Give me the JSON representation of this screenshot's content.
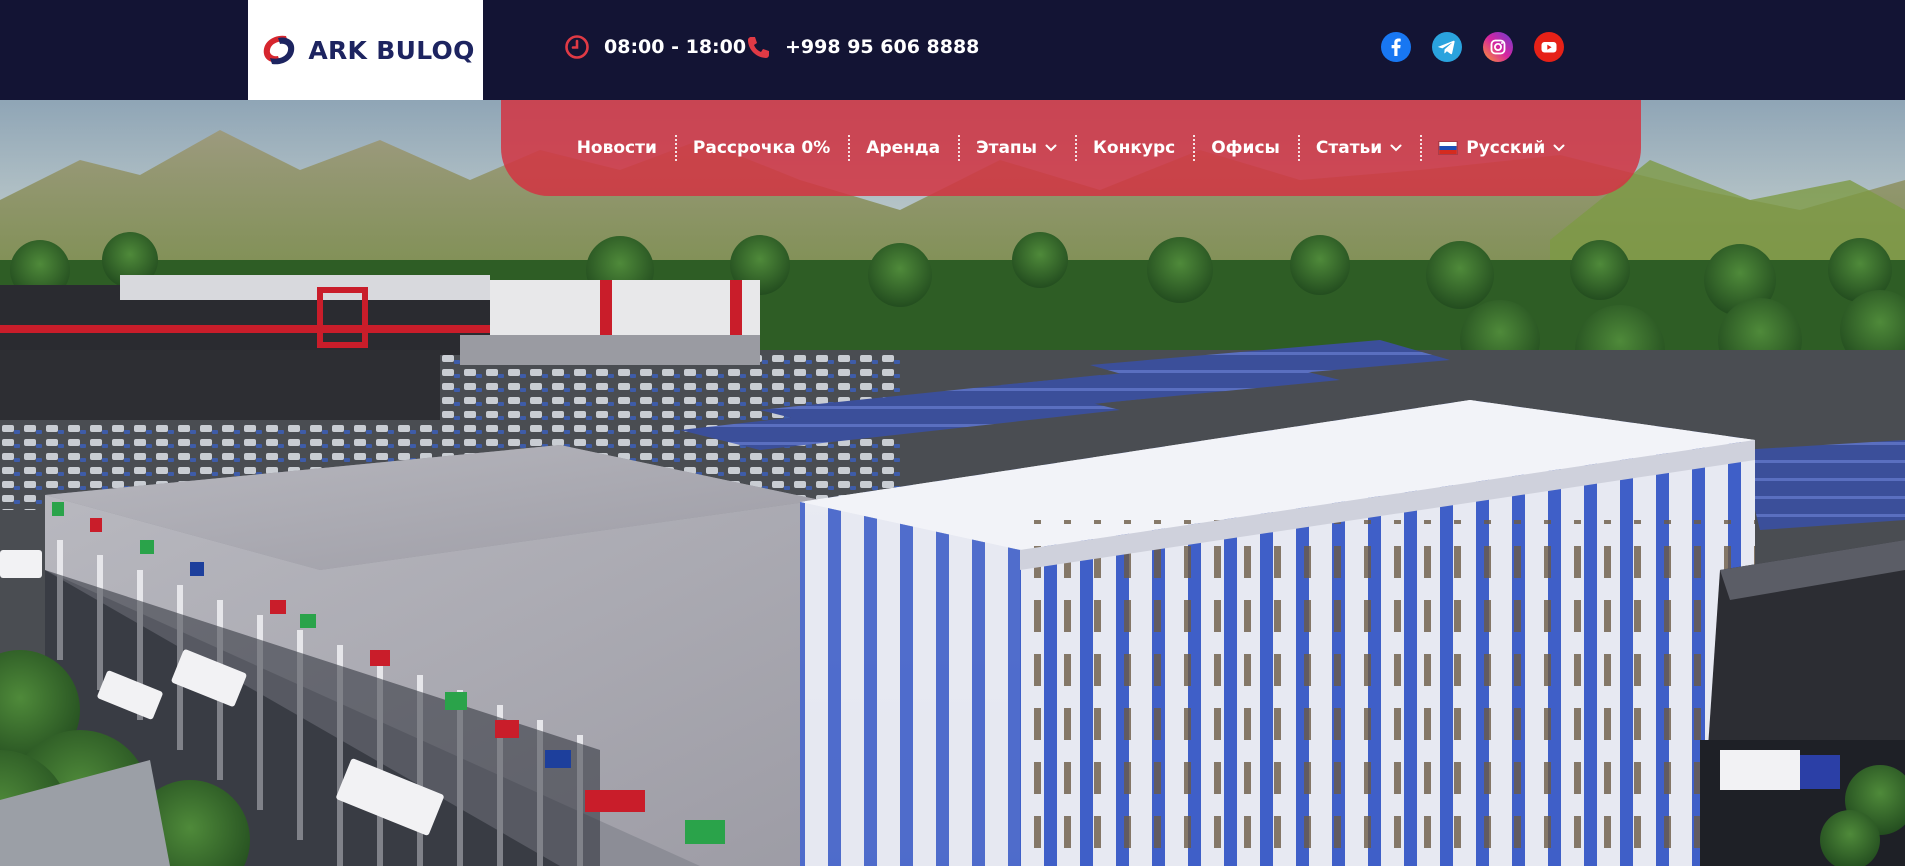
{
  "header": {
    "logo": {
      "text": "ARK BULOQ",
      "brand_color": "#1d2460",
      "accent_color": "#d6262e"
    },
    "hours": {
      "icon": "clock-icon",
      "text": "08:00 - 18:00"
    },
    "phone": {
      "icon": "phone-icon",
      "text": "+998 95 606 8888"
    },
    "socials": [
      {
        "name": "facebook-icon",
        "color": "#1877f2"
      },
      {
        "name": "telegram-icon",
        "color": "#2aa3de"
      },
      {
        "name": "instagram-icon",
        "color": "#d6249f"
      },
      {
        "name": "youtube-icon",
        "color": "#e62117"
      }
    ]
  },
  "nav": {
    "items": [
      {
        "label": "Новости",
        "dropdown": false
      },
      {
        "label": "Рассрочка 0%",
        "dropdown": false
      },
      {
        "label": "Аренда",
        "dropdown": false
      },
      {
        "label": "Этапы",
        "dropdown": true
      },
      {
        "label": "Конкурс",
        "dropdown": false
      },
      {
        "label": "Офисы",
        "dropdown": false
      },
      {
        "label": "Статьи",
        "dropdown": true
      },
      {
        "label": "Русский",
        "dropdown": true,
        "flag": "russia-flag"
      }
    ]
  },
  "colors": {
    "topbar": "#131434",
    "nav_bg": "#d23442",
    "text": "#ffffff"
  }
}
